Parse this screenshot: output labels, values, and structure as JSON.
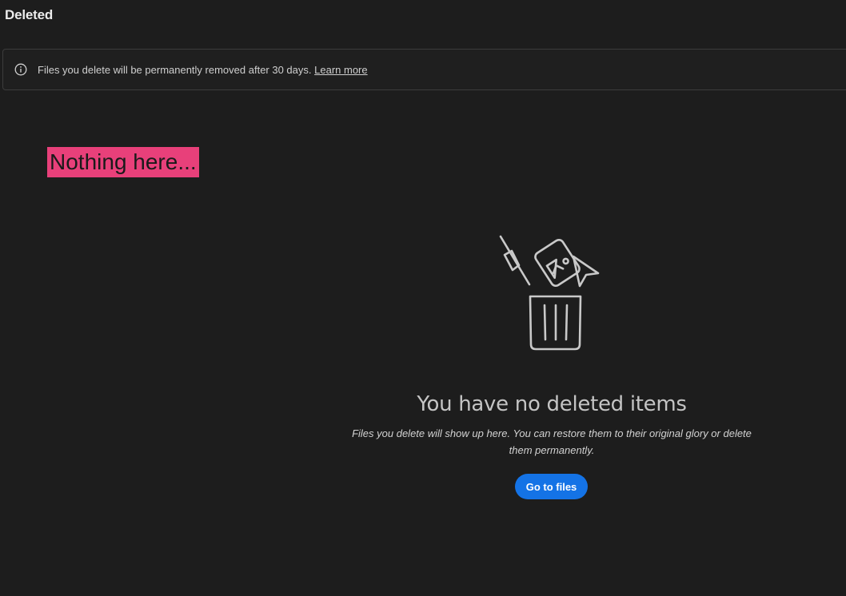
{
  "page": {
    "title": "Deleted"
  },
  "banner": {
    "icon": "info-icon",
    "message": "Files you delete will be permanently removed after 30 days.",
    "link_label": "Learn more"
  },
  "annotation": {
    "label": "Nothing here...",
    "color": "#e8407a"
  },
  "empty_state": {
    "illustration": "trash-can-with-files-icon",
    "title": "You have no deleted items",
    "description": "Files you delete will show up here. You can restore them to their original glory or delete them permanently.",
    "button_label": "Go to files",
    "button_color": "#1473e6"
  }
}
